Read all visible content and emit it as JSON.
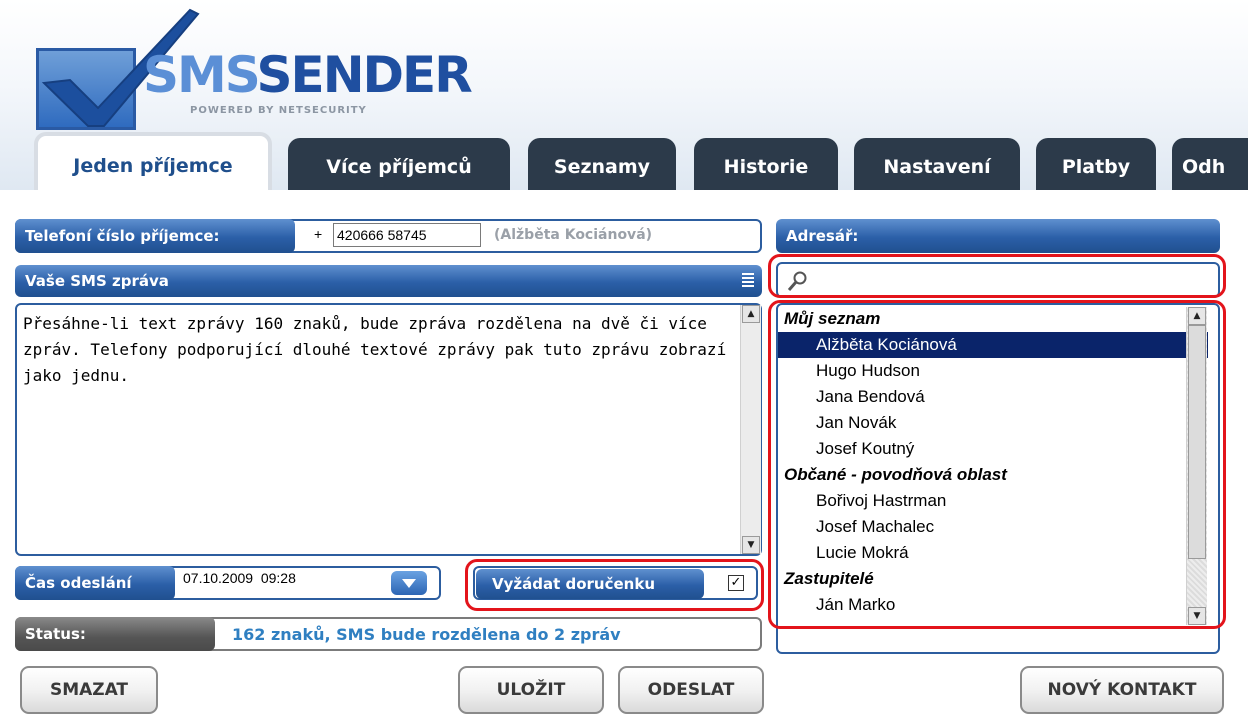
{
  "logo": {
    "text_light": "SMS",
    "text_bold": "SENDER",
    "tagline": "POWERED BY NETSECURITY"
  },
  "tabs": [
    {
      "label": "Jeden příjemce",
      "active": true
    },
    {
      "label": "Více příjemců"
    },
    {
      "label": "Seznamy"
    },
    {
      "label": "Historie"
    },
    {
      "label": "Nastavení"
    },
    {
      "label": "Platby"
    },
    {
      "label": "Odh"
    }
  ],
  "recipient": {
    "label": "Telefoní číslo příjemce:",
    "prefix": "+",
    "number": "420666 58745",
    "name": "(Alžběta Kociánová)"
  },
  "message": {
    "label": "Vaše SMS zpráva",
    "text": "Přesáhne-li text zprávy 160 znaků, bude zpráva rozdělena na dvě či více zpráv. Telefony podporující dlouhé textové zprávy pak tuto zprávu zobrazí jako jednu."
  },
  "send_time": {
    "label": "Čas odeslání",
    "value": "07.10.2009  09:28"
  },
  "delivery_report": {
    "label": "Vyžádat doručenku",
    "checked": true,
    "check_glyph": "✓"
  },
  "status": {
    "label": "Status:",
    "text": "162 znaků, SMS bude rozdělena do 2 zpráv"
  },
  "buttons": {
    "delete": "SMAZAT",
    "save": "ULOŽIT",
    "send": "ODESLAT",
    "new_contact": "NOVÝ KONTAKT"
  },
  "addressbook": {
    "label": "Adresář:",
    "search_placeholder": "",
    "groups": [
      {
        "name": "Můj seznam",
        "contacts": [
          "Alžběta Kociánová",
          "Hugo Hudson",
          "Jana Bendová",
          "Jan Novák",
          "Josef Koutný"
        ]
      },
      {
        "name": "Občané - povodňová oblast",
        "contacts": [
          "Bořivoj Hastrman",
          "Josef Machalec",
          "Lucie Mokrá"
        ]
      },
      {
        "name": "Zastupitelé",
        "contacts": [
          "Ján Marko"
        ]
      }
    ],
    "selected_contact": "Alžběta Kociánová"
  },
  "colors": {
    "accent": "#2b5fa8",
    "tab_dark": "#2c3a4a",
    "status_text": "#2f7fc1",
    "highlight": "#e3141b",
    "selection": "#0a246a"
  },
  "icons": [
    "checkmark-logo-icon",
    "menu-lines-icon",
    "chevron-down-icon",
    "magnifier-icon",
    "scroll-up-icon",
    "scroll-down-icon",
    "checkbox-icon"
  ]
}
